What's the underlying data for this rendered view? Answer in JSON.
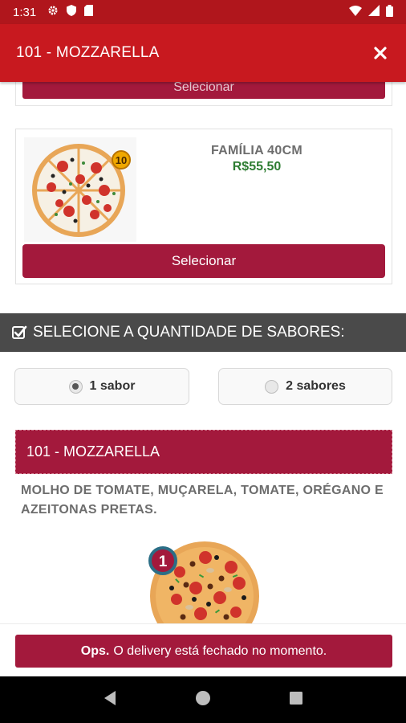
{
  "status_bar": {
    "time": "1:31"
  },
  "header": {
    "title": "101 - MOZZARELLA",
    "close_icon": "close-icon"
  },
  "prev_card": {
    "button_label": "Selecionar"
  },
  "size_card": {
    "name": "FAMÍLIA 40CM",
    "price": "R$55,50",
    "badge": "10",
    "button_label": "Selecionar"
  },
  "section": {
    "title": "SELECIONE A QUANTIDADE DE SABORES:",
    "icon": "checkbox-check-icon"
  },
  "flavor_options": [
    {
      "label": "1 sabor",
      "selected": true
    },
    {
      "label": "2 sabores",
      "selected": false
    }
  ],
  "flavor": {
    "title": "101 - MOZZARELLA",
    "description": "MOLHO DE TOMATE, MUÇARELA, TOMATE, ORÉGANO E AZEITONAS PRETAS.",
    "badge": "1"
  },
  "footer": {
    "bold": "Ops.",
    "message": "O delivery está fechado no momento."
  },
  "colors": {
    "header": "#c8191f",
    "button": "#a3193c",
    "section": "#4a4a4a",
    "price": "#2e7d32"
  }
}
